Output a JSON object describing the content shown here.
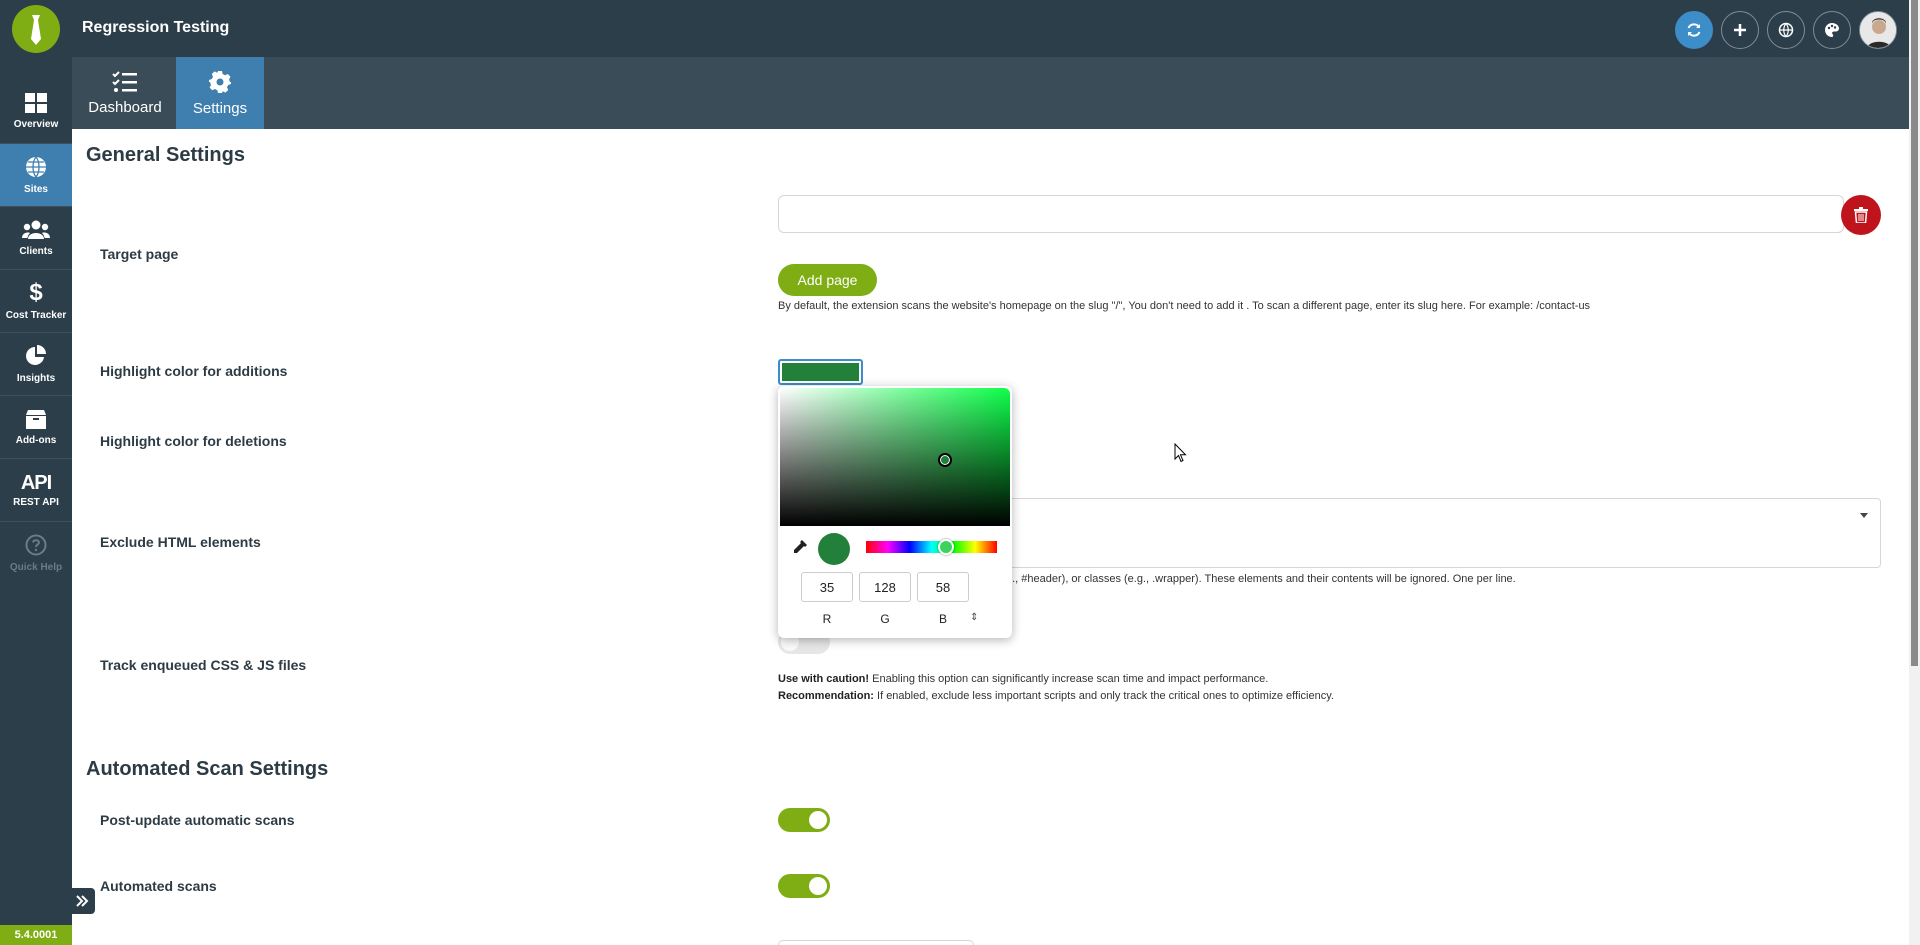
{
  "app": {
    "title": "Regression Testing",
    "version": "5.4.0001"
  },
  "colors": {
    "brand": "#7fad14",
    "sidebar": "#2c3e4a",
    "active": "#3e7fb0",
    "danger": "#c0141c",
    "picked": "#23803a"
  },
  "header": {
    "actions": [
      {
        "icon": "refresh-icon"
      },
      {
        "icon": "plus-icon"
      },
      {
        "icon": "globe-icon"
      },
      {
        "icon": "palette-icon"
      },
      {
        "icon": "avatar"
      }
    ]
  },
  "sidebar": {
    "items": [
      {
        "label": "Overview",
        "icon": "grid-icon"
      },
      {
        "label": "Sites",
        "icon": "globe-icon",
        "active": true
      },
      {
        "label": "Clients",
        "icon": "users-icon"
      },
      {
        "label": "Cost Tracker",
        "icon": "dollar-icon"
      },
      {
        "label": "Insights",
        "icon": "pie-chart-icon"
      },
      {
        "label": "Add-ons",
        "icon": "box-icon"
      },
      {
        "label": "REST API",
        "icon_text": "API"
      },
      {
        "label": "Quick Help",
        "icon": "question-icon"
      }
    ]
  },
  "subnav": {
    "tabs": [
      {
        "label": "Dashboard",
        "icon": "checklist-icon"
      },
      {
        "label": "Settings",
        "icon": "gear-icon",
        "active": true
      }
    ]
  },
  "general": {
    "title": "General Settings",
    "target_page_label": "Target page",
    "target_page_value": "",
    "add_page_label": "Add page",
    "target_help": "By default, the extension scans the website's homepage on the slug \"/\", You don't need to add it . To scan a different page, enter its slug here. For example: /contact-us",
    "additions_label": "Highlight color for additions",
    "deletions_label": "Highlight color for deletions",
    "exclude_label": "Exclude HTML elements",
    "exclude_help": "g., #header), or classes (e.g., .wrapper). These elements and their contents will be ignored. One per line.",
    "track_label": "Track enqueued CSS & JS files",
    "track_enabled": false,
    "caution_bold": "Use with caution!",
    "caution_text": " Enabling this option can significantly increase scan time and impact performance.",
    "recommend_bold": "Recommendation:",
    "recommend_text": " If enabled, exclude less important scripts and only track the critical ones to optimize efficiency."
  },
  "automated": {
    "title": "Automated Scan Settings",
    "post_update_label": "Post-update automatic scans",
    "post_update_enabled": true,
    "automated_label": "Automated scans",
    "automated_enabled": true
  },
  "picker": {
    "r": "35",
    "g": "128",
    "b": "58",
    "r_label": "R",
    "g_label": "G",
    "b_label": "B",
    "mode_toggle": "⇕"
  }
}
